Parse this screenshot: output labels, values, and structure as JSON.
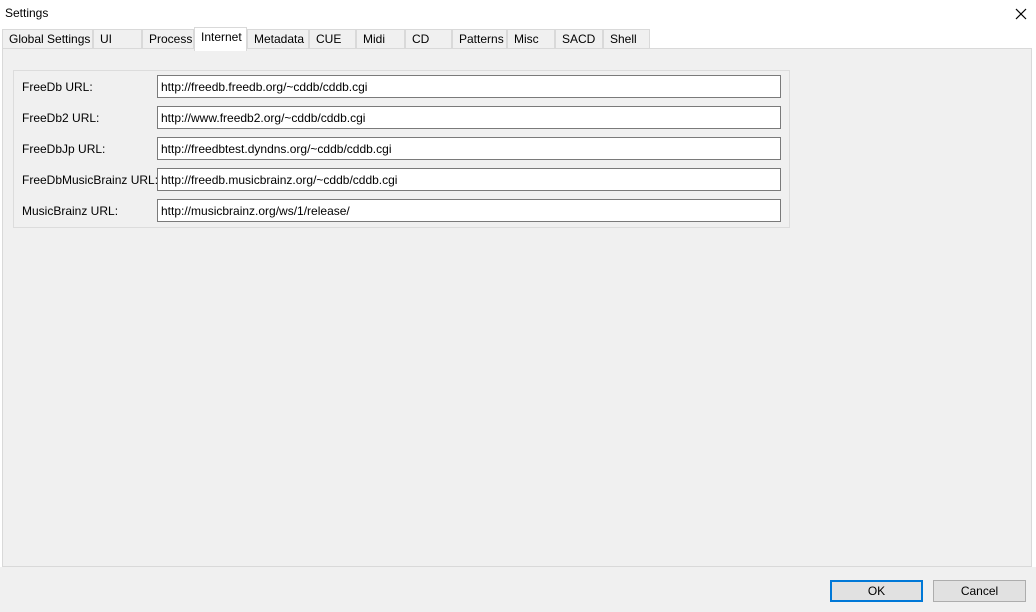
{
  "window": {
    "title": "Settings"
  },
  "tabs": [
    {
      "label": "Global Settings"
    },
    {
      "label": "UI"
    },
    {
      "label": "Process"
    },
    {
      "label": "Internet"
    },
    {
      "label": "Metadata"
    },
    {
      "label": "CUE"
    },
    {
      "label": "Midi"
    },
    {
      "label": "CD"
    },
    {
      "label": "Patterns"
    },
    {
      "label": "Misc"
    },
    {
      "label": "SACD"
    },
    {
      "label": "Shell"
    }
  ],
  "active_tab": "Internet",
  "internet": {
    "fields": [
      {
        "label": "FreeDb URL:",
        "value": "http://freedb.freedb.org/~cddb/cddb.cgi"
      },
      {
        "label": "FreeDb2 URL:",
        "value": "http://www.freedb2.org/~cddb/cddb.cgi"
      },
      {
        "label": "FreeDbJp URL:",
        "value": "http://freedbtest.dyndns.org/~cddb/cddb.cgi"
      },
      {
        "label": "FreeDbMusicBrainz URL:",
        "value": "http://freedb.musicbrainz.org/~cddb/cddb.cgi"
      },
      {
        "label": "MusicBrainz URL:",
        "value": "http://musicbrainz.org/ws/1/release/"
      }
    ]
  },
  "buttons": {
    "ok_label": "OK",
    "cancel_label": "Cancel"
  },
  "icons": {
    "close": "close-icon"
  },
  "colors": {
    "accent": "#0078d7",
    "panel": "#f0f0f0"
  }
}
